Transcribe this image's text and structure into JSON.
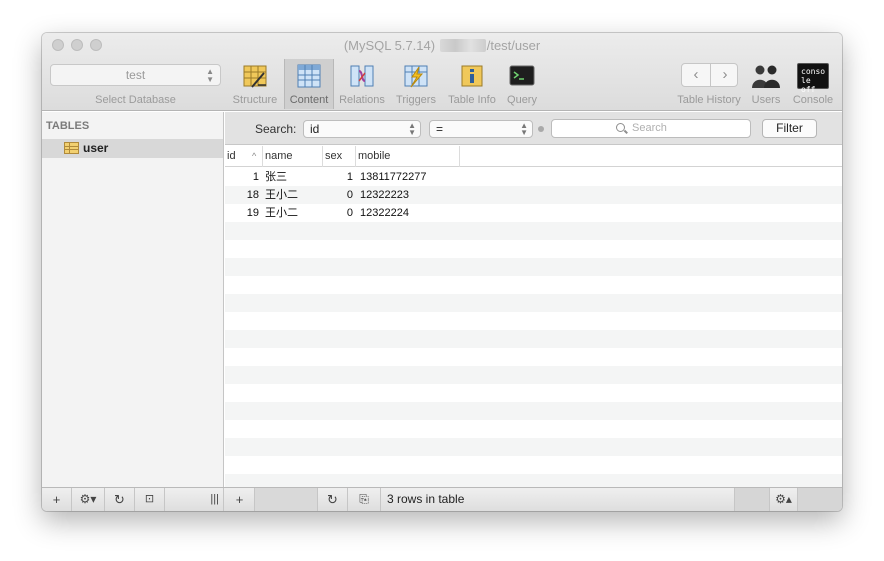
{
  "window": {
    "title_prefix": "(MySQL 5.7.14)",
    "title_suffix": "/test/user"
  },
  "toolbar": {
    "database_select": {
      "value": "test",
      "label": "Select Database"
    },
    "buttons": [
      {
        "label": "Structure",
        "icon": "structure-icon"
      },
      {
        "label": "Content",
        "icon": "content-icon",
        "active": true
      },
      {
        "label": "Relations",
        "icon": "relations-icon"
      },
      {
        "label": "Triggers",
        "icon": "triggers-icon"
      },
      {
        "label": "Table Info",
        "icon": "table-info-icon"
      },
      {
        "label": "Query",
        "icon": "query-icon"
      }
    ],
    "right_buttons": [
      {
        "label": "Table History",
        "icon": "history-nav-icon"
      },
      {
        "label": "Users",
        "icon": "users-icon"
      },
      {
        "label": "Console",
        "icon": "console-icon",
        "icon_text_line1": "conso",
        "icon_text_line2": "le off"
      }
    ]
  },
  "sidebar": {
    "heading": "TABLES",
    "items": [
      {
        "label": "user",
        "selected": true
      }
    ]
  },
  "filter": {
    "label": "Search:",
    "field": "id",
    "operator": "=",
    "search_placeholder": "Search",
    "button": "Filter"
  },
  "grid": {
    "columns": [
      "id",
      "name",
      "sex",
      "mobile"
    ],
    "rows": [
      {
        "id": "1",
        "name": "张三",
        "sex": "1",
        "mobile": "13811772277"
      },
      {
        "id": "18",
        "name": "王小二",
        "sex": "0",
        "mobile": "12322223"
      },
      {
        "id": "19",
        "name": "王小二",
        "sex": "0",
        "mobile": "12322224"
      }
    ]
  },
  "statusbar": {
    "rows_text": "3 rows in table"
  },
  "colors": {
    "toolbar_bg": "#dcdcdc",
    "selected_row": "#d8d8d8",
    "alt_row": "#f4f5f5",
    "active_tab": "#cfcfcf"
  }
}
